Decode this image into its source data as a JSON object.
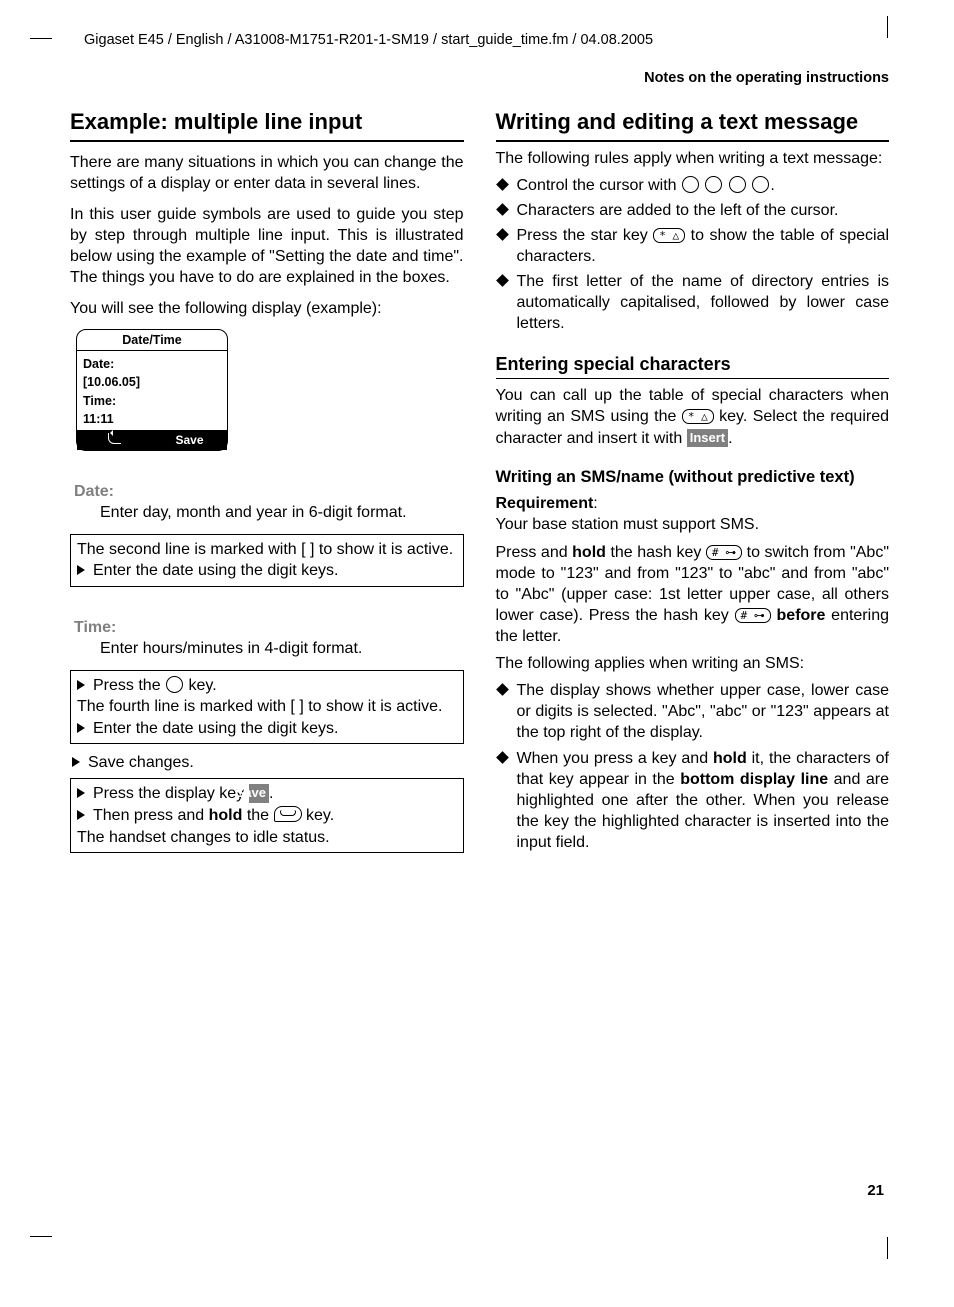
{
  "header": "Gigaset E45 / English / A31008-M1751-R201-1-SM19 / start_guide_time.fm / 04.08.2005",
  "notes": "Notes on the operating instructions",
  "page_number": "21",
  "left": {
    "h2": "Example: multiple line input",
    "p1": "There are many situations in which you can change the settings of a display or enter data in several lines.",
    "p2": "In this user guide symbols are used to guide you step by step through multiple line input. This is illustrated below using the example of \"Setting the date and time\". The things you have to do are explained in the boxes.",
    "p3": "You will see the following display (example):",
    "display": {
      "title": "Date/Time",
      "l1": "Date:",
      "l2": "[10.06.05]",
      "l3": "Time:",
      "l4": "11:11",
      "save": "Save"
    },
    "date_label": "Date:",
    "date_desc": "Enter day, month and year in 6-digit format.",
    "box1a": "The second line is marked with [  ] to show it is active.",
    "box1b": "Enter the date using the digit keys.",
    "time_label": "Time:",
    "time_desc": "Enter hours/minutes in 4-digit format.",
    "box2a_pre": "Press the ",
    "box2a_post": " key.",
    "box2b": "The fourth line is marked with [  ] to show it is active.",
    "box2c": "Enter the date using the digit keys.",
    "save_changes": "Save changes.",
    "box3a_pre": "Press the display key ",
    "box3a_post": ".",
    "box3b_pre": "Then press and ",
    "box3b_hold": "hold",
    "box3b_mid": " the ",
    "box3b_post": " key.",
    "box3c": "The handset changes to idle status.",
    "save_key": "Save"
  },
  "right": {
    "h2": "Writing and editing a text message",
    "p1": "The following rules apply when writing a text message:",
    "b1_pre": "Control the cursor with ",
    "b1_post": ".",
    "b2": "Characters are added to the left of the cursor.",
    "b3_pre": "Press the star key ",
    "b3_post": " to show the table of special characters.",
    "b4": "The first letter of the name of directory entries is automatically capitalised, followed by lower case letters.",
    "h3": "Entering special characters",
    "p2_pre": "You can call up the table of special characters when writing an SMS using the ",
    "p2_mid": " key. Select the required character and insert it with ",
    "p2_post": ".",
    "insert_key": "Insert",
    "h4": "Writing an SMS/name (without predictive text)",
    "req_label": "Requirement",
    "req_text": "Your base station must support SMS.",
    "p3_pre": "Press and ",
    "p3_hold": "hold",
    "p3_mid1": " the hash key ",
    "p3_mid2": " to switch from \"Abc\" mode to \"123\" and from \"123\" to \"abc\" and from \"abc\" to \"Abc\" (upper case: 1st letter upper case, all others lower case). Press the hash key ",
    "p3_before": "before",
    "p3_post": " entering the letter.",
    "p4": "The following applies when writing an SMS:",
    "b5": "The display shows whether upper case, lower case or digits is selected. \"Abc\", \"abc\" or \"123\" appears at the top right of the display.",
    "b6_pre": "When you press a key and ",
    "b6_hold": "hold",
    "b6_mid": " it, the characters of that key appear in the ",
    "b6_bold": "bottom display line",
    "b6_post": " and are highlighted one after the other. When you release the key the highlighted character is inserted into the input field.",
    "star_key": "* △",
    "hash_key": "# ⊶"
  }
}
